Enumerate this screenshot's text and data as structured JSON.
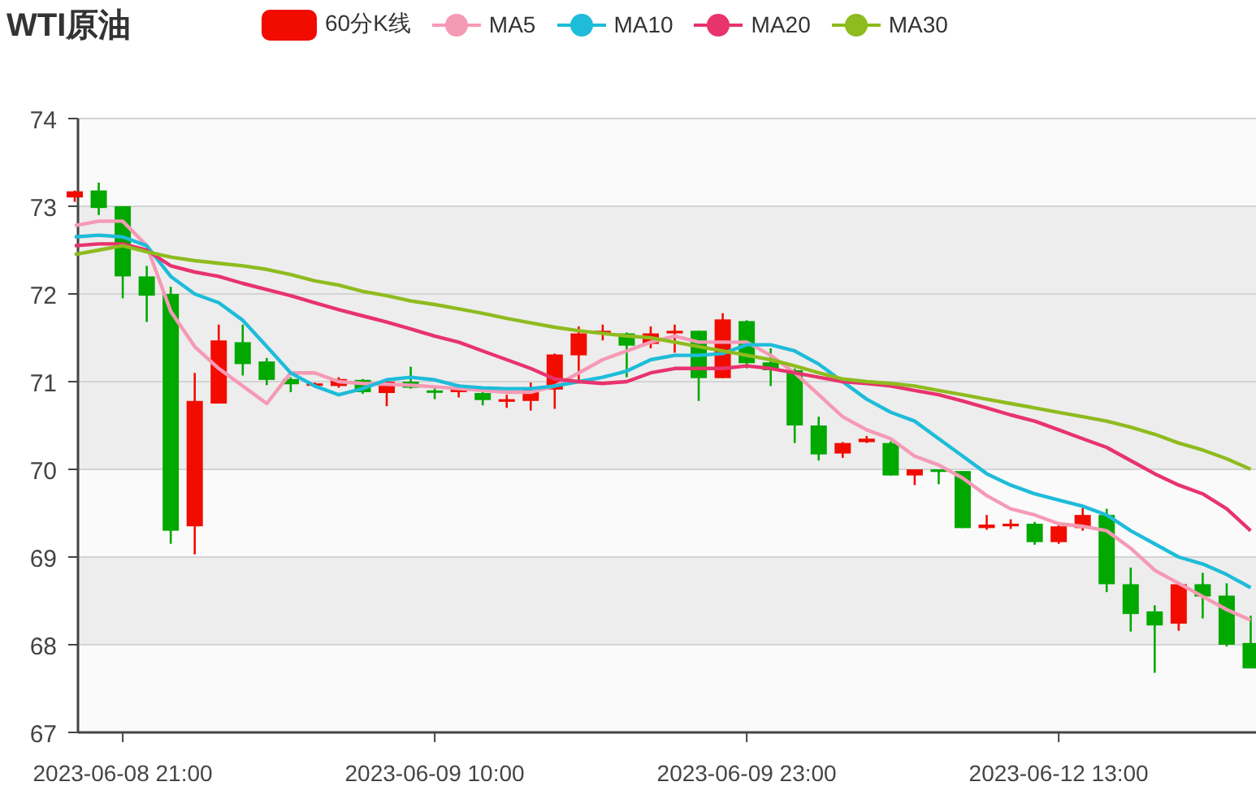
{
  "title": "WTI原油",
  "legend": [
    {
      "label": "60分K线",
      "color": "#f20c00"
    }
  ],
  "chart_data": {
    "type": "candlestick",
    "grid": true,
    "ylim": [
      67,
      74
    ],
    "yticks": [
      67,
      68,
      69,
      70,
      71,
      72,
      73,
      74
    ],
    "categories": [
      null,
      null,
      "2023-06-08 21:00",
      null,
      null,
      null,
      null,
      null,
      null,
      null,
      null,
      null,
      null,
      null,
      null,
      "2023-06-09 10:00",
      null,
      null,
      null,
      null,
      null,
      null,
      null,
      null,
      null,
      null,
      null,
      null,
      "2023-06-09 23:00",
      null,
      null,
      null,
      null,
      null,
      null,
      null,
      null,
      null,
      null,
      null,
      null,
      "2023-06-12 13:00",
      null,
      null,
      null,
      null,
      null,
      null,
      null,
      null
    ],
    "ohlc": [
      [
        73.1,
        73.18,
        73.05,
        73.17
      ],
      [
        73.18,
        73.27,
        72.9,
        72.98
      ],
      [
        73.0,
        73.0,
        71.95,
        72.2
      ],
      [
        72.2,
        72.32,
        71.68,
        71.98
      ],
      [
        72.0,
        72.08,
        69.15,
        69.3
      ],
      [
        69.35,
        71.1,
        69.03,
        70.78
      ],
      [
        70.75,
        71.65,
        70.75,
        71.47
      ],
      [
        71.45,
        71.65,
        71.07,
        71.2
      ],
      [
        71.23,
        71.27,
        70.96,
        71.02
      ],
      [
        71.03,
        71.05,
        70.88,
        70.97
      ],
      [
        70.97,
        70.99,
        70.96,
        70.98
      ],
      [
        70.95,
        71.05,
        70.93,
        71.03
      ],
      [
        71.02,
        71.03,
        70.86,
        70.88
      ],
      [
        70.87,
        71.01,
        70.72,
        71.0
      ],
      [
        71.0,
        71.17,
        70.92,
        70.93
      ],
      [
        70.9,
        70.95,
        70.8,
        70.88
      ],
      [
        70.88,
        70.97,
        70.82,
        70.91
      ],
      [
        70.87,
        70.88,
        70.73,
        70.79
      ],
      [
        70.77,
        70.85,
        70.7,
        70.8
      ],
      [
        70.78,
        70.99,
        70.67,
        70.91
      ],
      [
        70.91,
        71.32,
        70.69,
        71.31
      ],
      [
        71.3,
        71.63,
        70.98,
        71.55
      ],
      [
        71.55,
        71.65,
        71.47,
        71.58
      ],
      [
        71.55,
        71.56,
        71.05,
        71.41
      ],
      [
        71.43,
        71.63,
        71.38,
        71.55
      ],
      [
        71.55,
        71.65,
        71.33,
        71.58
      ],
      [
        71.58,
        71.58,
        70.78,
        71.04
      ],
      [
        71.04,
        71.78,
        71.04,
        71.71
      ],
      [
        71.69,
        71.7,
        71.15,
        71.21
      ],
      [
        71.22,
        71.38,
        70.95,
        71.13
      ],
      [
        71.13,
        71.15,
        70.3,
        70.5
      ],
      [
        70.5,
        70.6,
        70.1,
        70.17
      ],
      [
        70.18,
        70.31,
        70.13,
        70.3
      ],
      [
        70.31,
        70.38,
        70.3,
        70.35
      ],
      [
        70.3,
        70.32,
        69.93,
        69.93
      ],
      [
        69.93,
        70.0,
        69.82,
        70.0
      ],
      [
        70.0,
        70.0,
        69.83,
        69.97
      ],
      [
        69.98,
        69.98,
        69.33,
        69.33
      ],
      [
        69.33,
        69.48,
        69.31,
        69.37
      ],
      [
        69.35,
        69.43,
        69.32,
        69.38
      ],
      [
        69.38,
        69.4,
        69.14,
        69.17
      ],
      [
        69.17,
        69.38,
        69.15,
        69.35
      ],
      [
        69.33,
        69.56,
        69.3,
        69.48
      ],
      [
        69.48,
        69.55,
        68.6,
        68.69
      ],
      [
        68.69,
        68.88,
        68.15,
        68.35
      ],
      [
        68.38,
        68.45,
        67.68,
        68.22
      ],
      [
        68.24,
        68.69,
        68.16,
        68.69
      ],
      [
        68.69,
        68.82,
        68.3,
        68.55
      ],
      [
        68.56,
        68.7,
        67.98,
        68.0
      ],
      [
        68.02,
        68.33,
        67.73,
        67.73
      ]
    ],
    "series": [
      {
        "name": "MA5",
        "type": "line",
        "color": "#f59ab5",
        "values": [
          72.78,
          72.83,
          72.83,
          72.55,
          71.8,
          71.4,
          71.15,
          70.95,
          70.75,
          71.1,
          71.1,
          71.0,
          70.98,
          70.97,
          70.96,
          70.94,
          70.92,
          70.9,
          70.88,
          70.88,
          70.95,
          71.1,
          71.25,
          71.35,
          71.45,
          71.52,
          71.45,
          71.45,
          71.45,
          71.3,
          71.1,
          70.85,
          70.6,
          70.45,
          70.35,
          70.15,
          70.05,
          69.9,
          69.7,
          69.55,
          69.48,
          69.38,
          69.35,
          69.3,
          69.1,
          68.85,
          68.7,
          68.55,
          68.4,
          68.28
        ]
      },
      {
        "name": "MA10",
        "type": "line",
        "color": "#1ebcd9",
        "values": [
          72.65,
          72.67,
          72.65,
          72.55,
          72.2,
          72.0,
          71.9,
          71.7,
          71.4,
          71.1,
          70.95,
          70.85,
          70.92,
          71.02,
          71.05,
          71.02,
          70.95,
          70.93,
          70.92,
          70.92,
          70.95,
          71.0,
          71.05,
          71.12,
          71.25,
          71.3,
          71.3,
          71.32,
          71.42,
          71.42,
          71.35,
          71.2,
          71.0,
          70.8,
          70.65,
          70.55,
          70.35,
          70.15,
          69.95,
          69.82,
          69.72,
          69.65,
          69.58,
          69.48,
          69.3,
          69.15,
          69.0,
          68.92,
          68.8,
          68.65
        ]
      },
      {
        "name": "MA20",
        "type": "line",
        "color": "#e8336d",
        "values": [
          72.55,
          72.57,
          72.57,
          72.5,
          72.32,
          72.25,
          72.2,
          72.12,
          72.05,
          71.98,
          71.9,
          71.82,
          71.75,
          71.68,
          71.6,
          71.52,
          71.45,
          71.35,
          71.25,
          71.15,
          71.03,
          71.0,
          70.98,
          71.0,
          71.1,
          71.15,
          71.15,
          71.15,
          71.18,
          71.15,
          71.1,
          71.05,
          71.0,
          70.98,
          70.95,
          70.9,
          70.85,
          70.78,
          70.7,
          70.62,
          70.55,
          70.45,
          70.35,
          70.25,
          70.1,
          69.95,
          69.82,
          69.72,
          69.55,
          69.3
        ]
      },
      {
        "name": "MA30",
        "type": "line",
        "color": "#8fbb1e",
        "values": [
          72.45,
          72.5,
          72.55,
          72.48,
          72.42,
          72.38,
          72.35,
          72.32,
          72.28,
          72.22,
          72.15,
          72.1,
          72.03,
          71.98,
          71.92,
          71.88,
          71.83,
          71.78,
          71.72,
          71.67,
          71.62,
          71.58,
          71.55,
          71.52,
          71.5,
          71.45,
          71.4,
          71.35,
          71.3,
          71.25,
          71.18,
          71.1,
          71.03,
          71.0,
          70.98,
          70.95,
          70.9,
          70.85,
          70.8,
          70.75,
          70.7,
          70.65,
          70.6,
          70.55,
          70.48,
          70.4,
          70.3,
          70.22,
          70.12,
          70.0
        ]
      }
    ]
  }
}
